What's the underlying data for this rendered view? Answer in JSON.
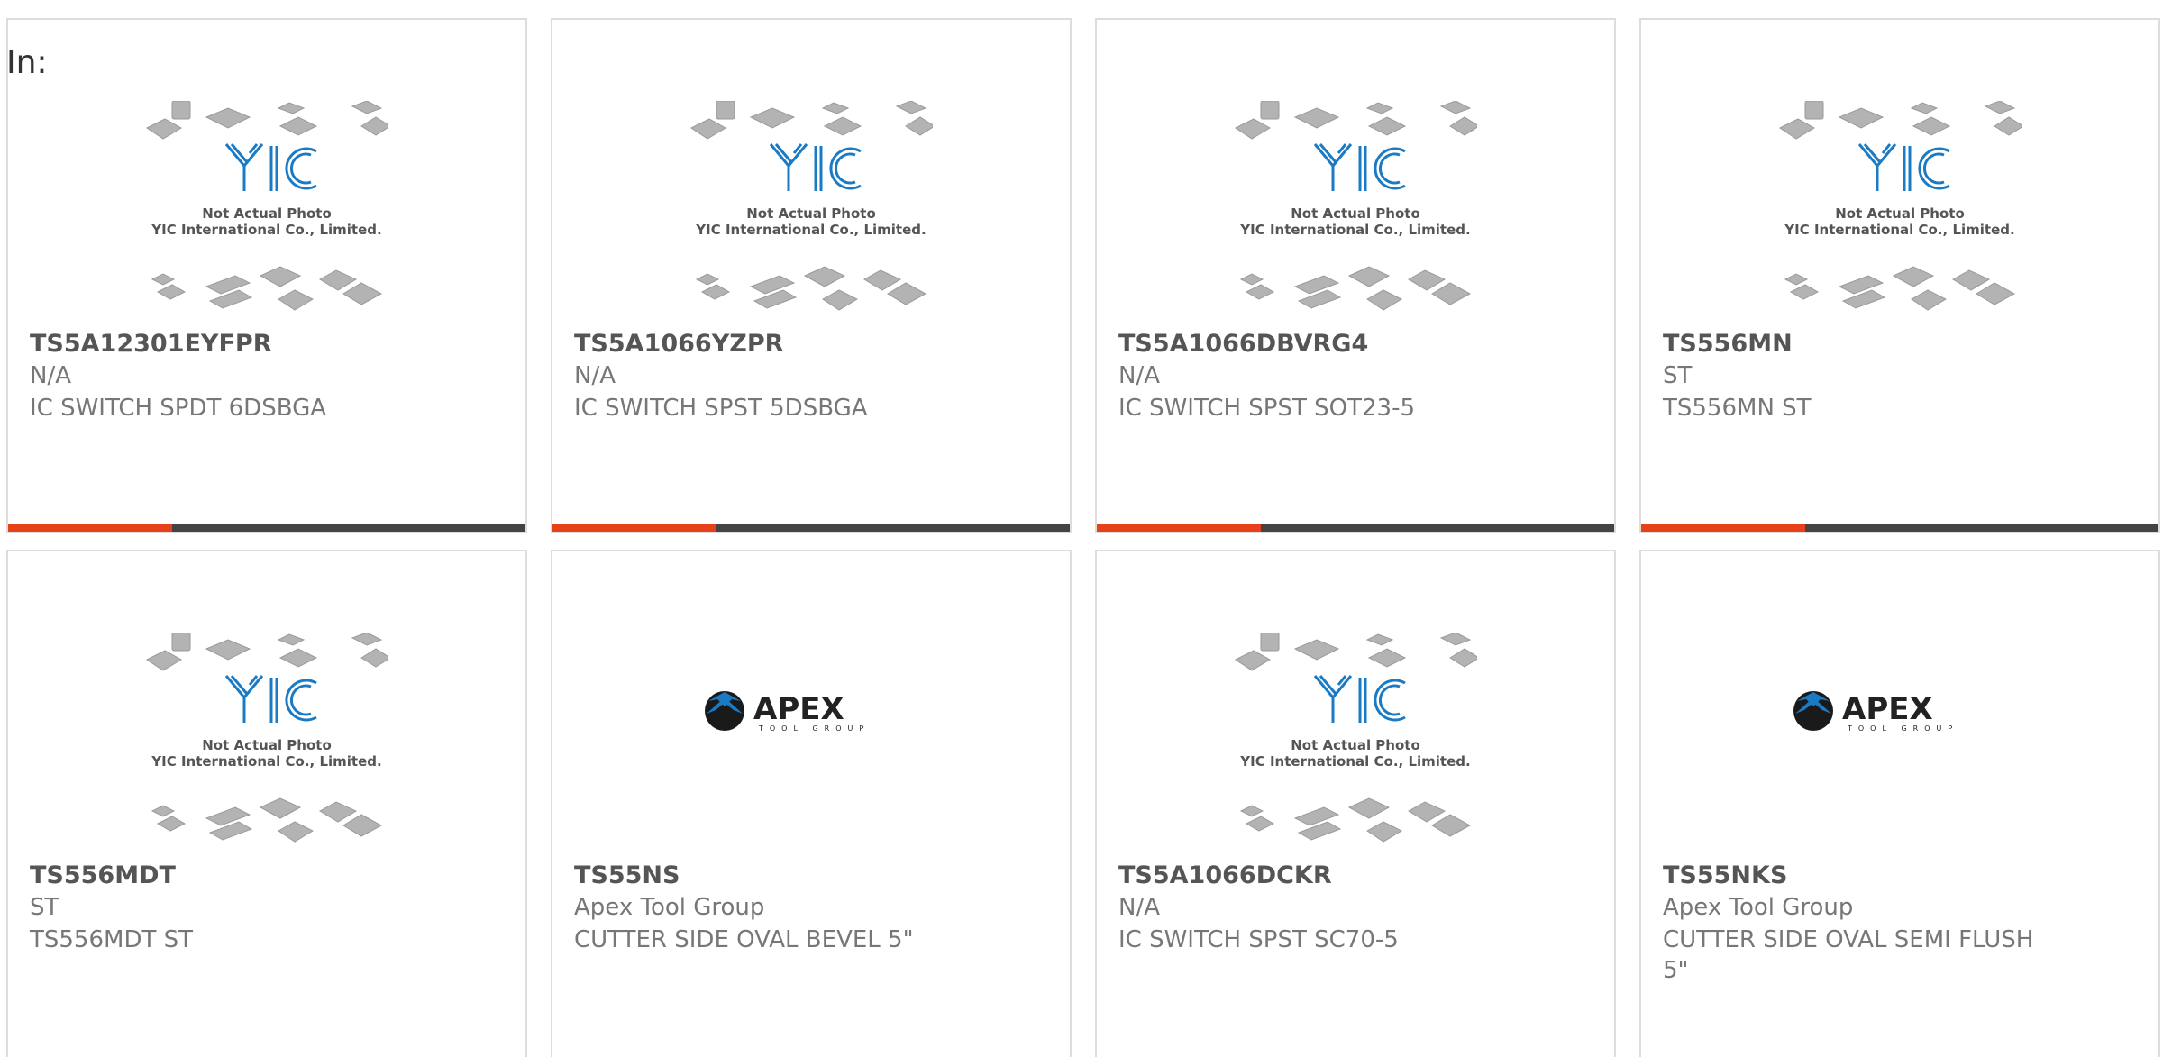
{
  "header": {
    "in_label": "In:"
  },
  "placeholder": {
    "line1": "Not Actual Photo",
    "line2": "YIC International Co., Limited."
  },
  "apex_logo": {
    "wordmark": "APEX",
    "tagline": "TOOL GROUP"
  },
  "colors": {
    "accent": "#e8411a",
    "bar_dark": "#444444",
    "yic_blue": "#1a7bc4"
  },
  "products": [
    {
      "part_number": "TS5A12301EYFPR",
      "manufacturer": "N/A",
      "description": "IC SWITCH SPDT 6DSBGA",
      "image": "yic-placeholder"
    },
    {
      "part_number": "TS5A1066YZPR",
      "manufacturer": "N/A",
      "description": "IC SWITCH SPST 5DSBGA",
      "image": "yic-placeholder"
    },
    {
      "part_number": "TS5A1066DBVRG4",
      "manufacturer": "N/A",
      "description": "IC SWITCH SPST SOT23-5",
      "image": "yic-placeholder"
    },
    {
      "part_number": "TS556MN",
      "manufacturer": "ST",
      "description": "TS556MN ST",
      "image": "yic-placeholder"
    },
    {
      "part_number": "TS556MDT",
      "manufacturer": "ST",
      "description": "TS556MDT ST",
      "image": "yic-placeholder"
    },
    {
      "part_number": "TS55NS",
      "manufacturer": "Apex Tool Group",
      "description": "CUTTER SIDE OVAL BEVEL 5\"",
      "image": "apex-logo"
    },
    {
      "part_number": "TS5A1066DCKR",
      "manufacturer": "N/A",
      "description": "IC SWITCH SPST SC70-5",
      "image": "yic-placeholder"
    },
    {
      "part_number": "TS55NKS",
      "manufacturer": "Apex Tool Group",
      "description": "CUTTER SIDE OVAL SEMI FLUSH 5\"",
      "image": "apex-logo"
    }
  ]
}
